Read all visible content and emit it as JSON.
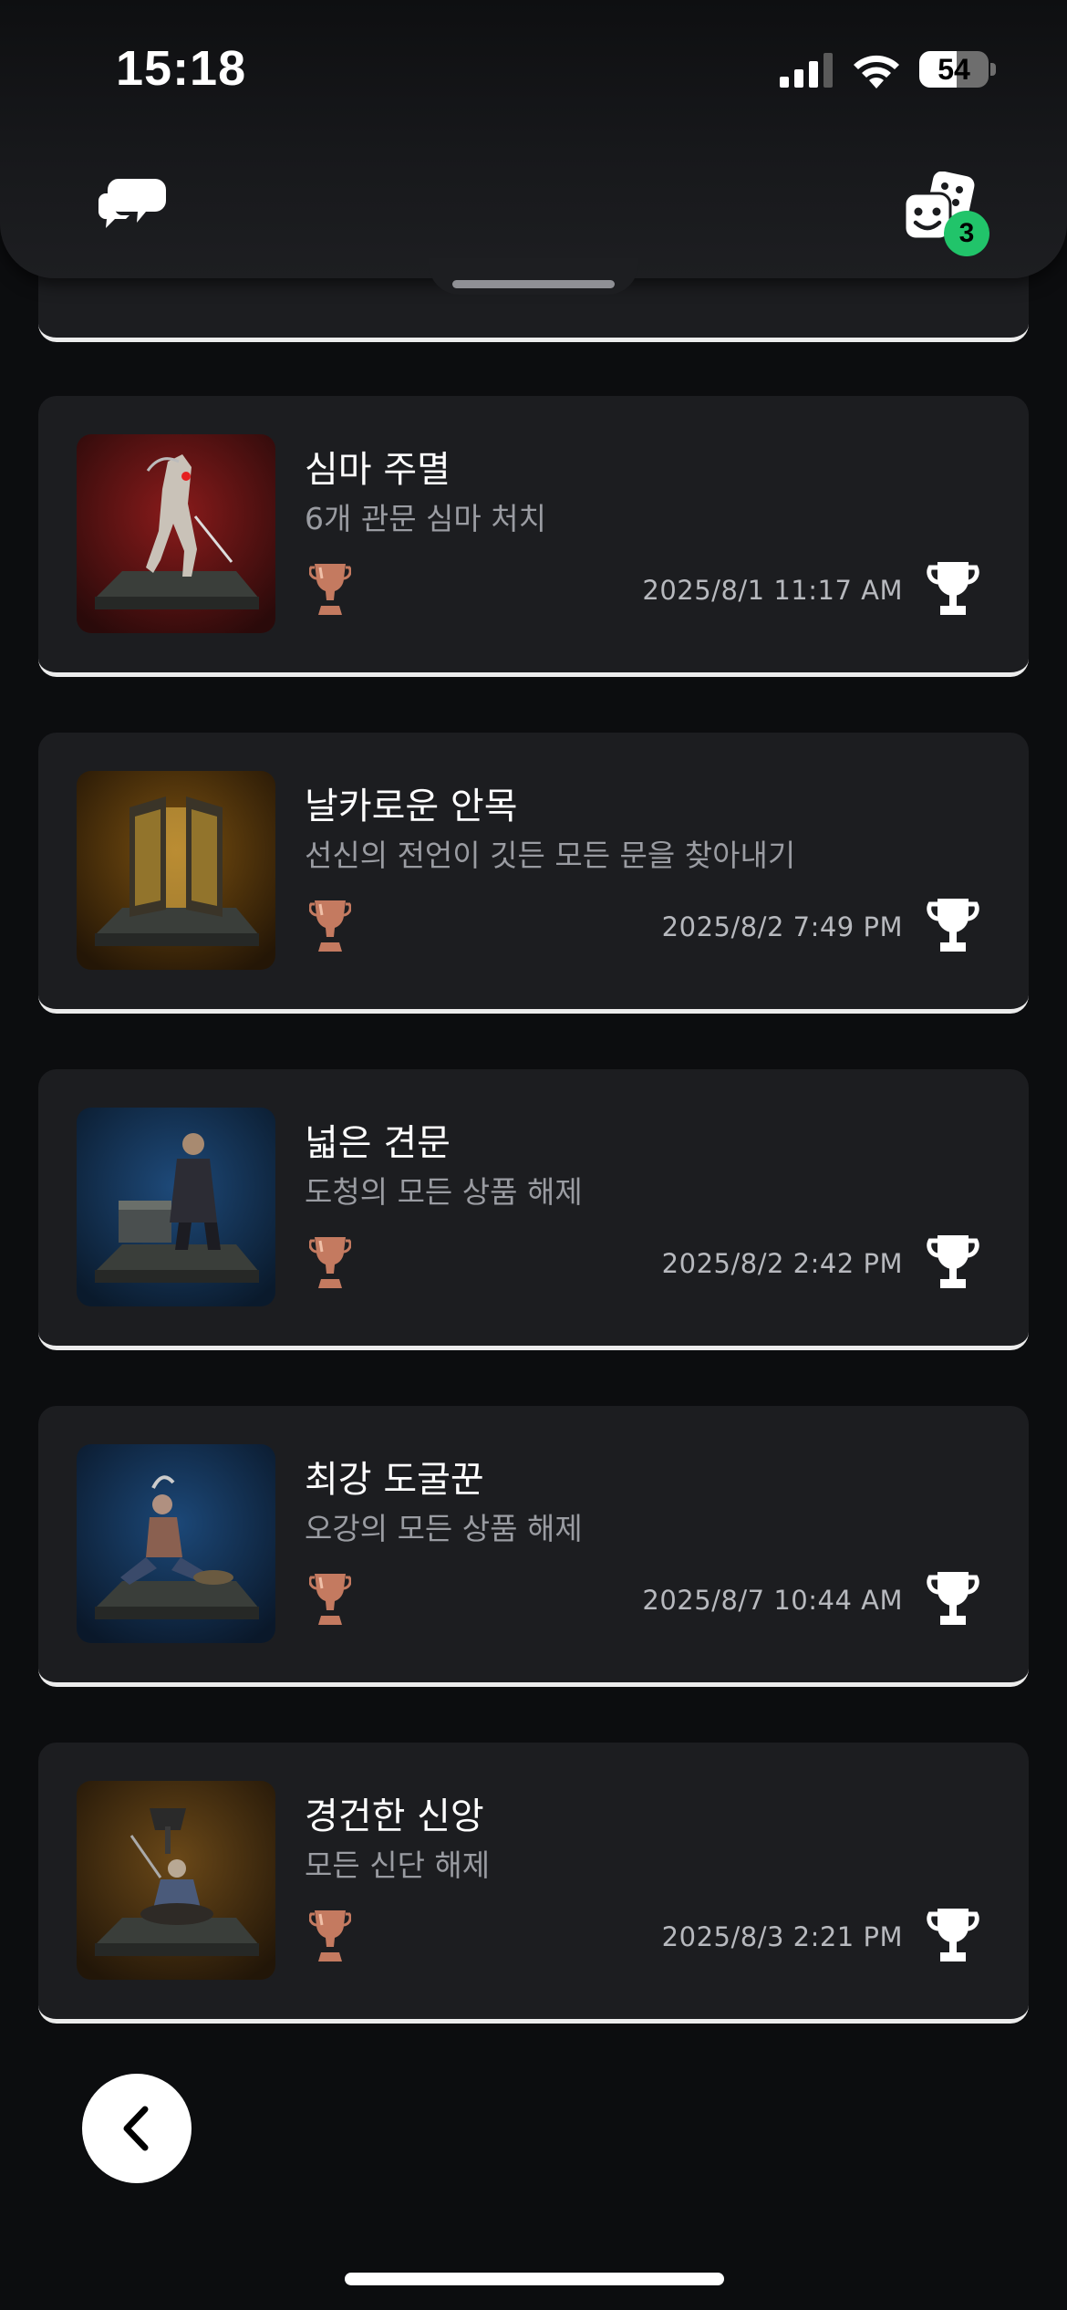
{
  "status_bar": {
    "time": "15:18",
    "battery_level": "54",
    "signal_icon": "cellular-signal-icon",
    "wifi_icon": "wifi-icon",
    "battery_icon": "battery-icon"
  },
  "header": {
    "left_icon": "chat-bubbles-icon",
    "right_icon": "dice-face-icon",
    "badge_count": "3",
    "badge_color": "#21c46a"
  },
  "achievements": [
    {
      "title": "심마 주멸",
      "description": "6개 관문 심마 처치",
      "date": "2025/8/1  11:17 AM",
      "tier": "bronze"
    },
    {
      "title": "날카로운 안목",
      "description": "선신의 전언이 깃든 모든 문을 찾아내기",
      "date": "2025/8/2  7:49 PM",
      "tier": "bronze"
    },
    {
      "title": "넓은 견문",
      "description": "도청의 모든 상품 해제",
      "date": "2025/8/2  2:42 PM",
      "tier": "bronze"
    },
    {
      "title": "최강 도굴꾼",
      "description": "오강의 모든 상품 해제",
      "date": "2025/8/7  10:44 AM",
      "tier": "bronze"
    },
    {
      "title": "경건한 신앙",
      "description": "모든 신단 해제",
      "date": "2025/8/3  2:21 PM",
      "tier": "bronze"
    }
  ],
  "colors": {
    "background": "#0c0d0f",
    "card": "#1c1d20",
    "bronze": "#c47a60",
    "accent_green": "#21c46a"
  },
  "navigation": {
    "back_icon": "chevron-left-icon"
  }
}
